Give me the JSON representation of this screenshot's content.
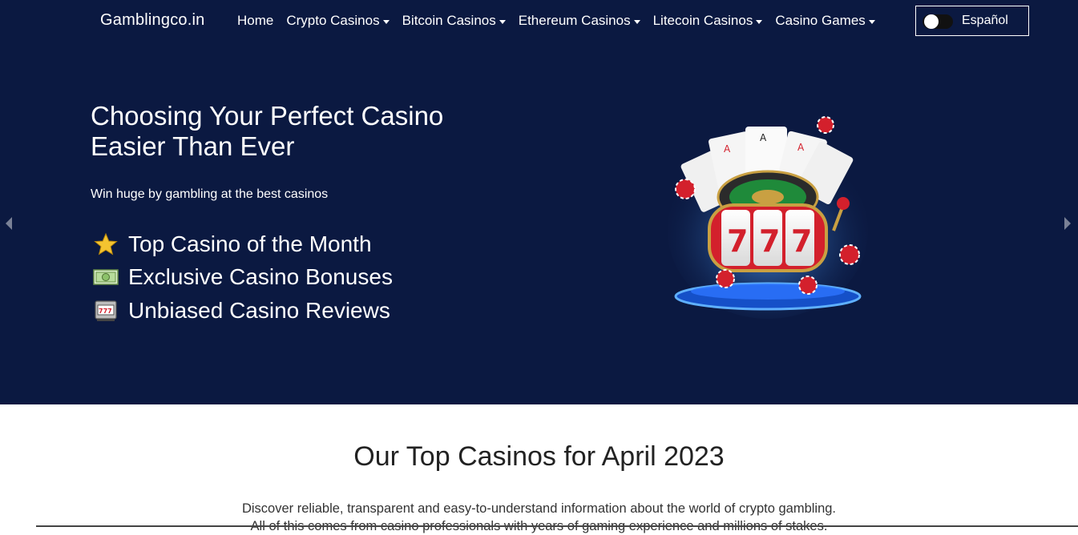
{
  "nav": {
    "brand": "Gamblingco.in",
    "items": [
      {
        "label": "Home",
        "dropdown": false
      },
      {
        "label": "Crypto Casinos",
        "dropdown": true
      },
      {
        "label": "Bitcoin Casinos",
        "dropdown": true
      },
      {
        "label": "Ethereum Casinos",
        "dropdown": true
      },
      {
        "label": "Litecoin Casinos",
        "dropdown": true
      },
      {
        "label": "Casino Games",
        "dropdown": true
      }
    ],
    "language_toggle": {
      "label": "Español",
      "enabled": false
    }
  },
  "hero": {
    "title": "Choosing Your Perfect Casino Easier Than Ever",
    "subtitle": "Win huge by gambling at the best casinos",
    "features": [
      {
        "icon": "star-icon",
        "label": "Top Casino of the Month"
      },
      {
        "icon": "money-icon",
        "label": "Exclusive Casino Bonuses"
      },
      {
        "icon": "slot-machine-icon",
        "label": "Unbiased Casino Reviews"
      }
    ]
  },
  "section": {
    "title": "Our Top Casinos for April 2023",
    "text_line1": "Discover reliable, transparent and easy-to-understand information about the world of crypto gambling.",
    "text_line2": "All of this comes from casino professionals with years of gaming experience and millions of stakes."
  },
  "colors": {
    "hero_bg": "#0b1941",
    "accent_star": "#f4c430",
    "slot_red": "#d3202c"
  }
}
